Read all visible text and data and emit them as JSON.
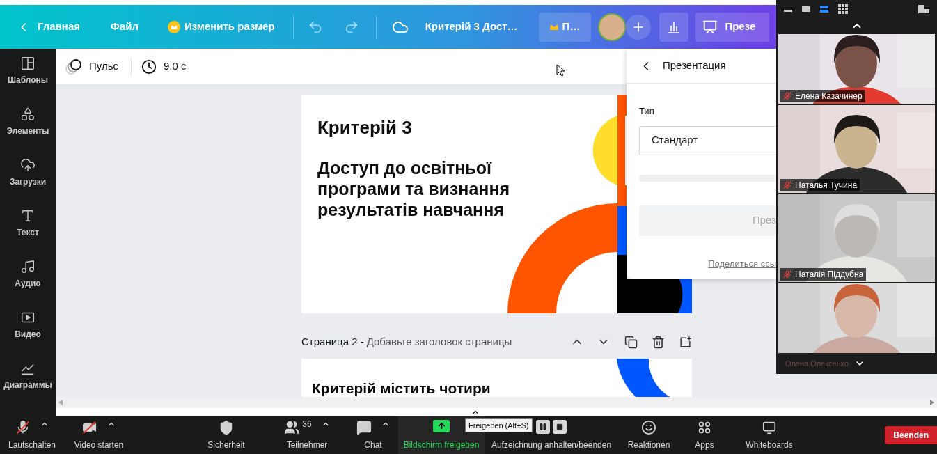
{
  "canva": {
    "header": {
      "back": "Главная",
      "file": "Файл",
      "resize": "Изменить размер",
      "title": "Критерій 3 Дост…",
      "pro": "П…",
      "present": "Презе"
    },
    "toolbar": {
      "animation": "Пульс",
      "duration": "9.0 с"
    },
    "sidebar": [
      {
        "kind": "templates",
        "label": "Шаблоны"
      },
      {
        "kind": "elements",
        "label": "Элементы"
      },
      {
        "kind": "uploads",
        "label": "Загрузки"
      },
      {
        "kind": "text",
        "label": "Текст"
      },
      {
        "kind": "audio",
        "label": "Аудио"
      },
      {
        "kind": "video",
        "label": "Видео"
      },
      {
        "kind": "charts",
        "label": "Диаграммы"
      }
    ],
    "slide_1": {
      "heading": "Критерій 3",
      "subheading": "Доступ до освітньої програми та визнання результатів навчання"
    },
    "page_2": {
      "label": "Страница 2 -",
      "title_placeholder": "Добавьте заголовок страницы",
      "slide_text": "Критерій містить чотири"
    },
    "present_panel": {
      "title": "Презентация",
      "type_label": "Тип",
      "type_value": "Стандарт",
      "button": "През",
      "share_link": "Поделиться ссы"
    }
  },
  "zoom": {
    "gallery": {
      "tiles": [
        {
          "name": "Елена Казачинер",
          "muted": true
        },
        {
          "name": "Наталья Тучина",
          "muted": true
        },
        {
          "name": "Наталія Піддубна",
          "muted": true
        }
      ],
      "partial_name": "Олена Олексенко"
    },
    "toolbar": [
      {
        "kind": "mic",
        "label": "Lautschalten",
        "off": true,
        "menu": true
      },
      {
        "kind": "video",
        "label": "Video starten",
        "off": true,
        "menu": true
      },
      {
        "kind": "security",
        "label": "Sicherheit",
        "off": false,
        "menu": false
      },
      {
        "kind": "participants",
        "label": "Teilnehmer",
        "count": "36",
        "off": false,
        "menu": true
      },
      {
        "kind": "chat",
        "label": "Chat",
        "off": false,
        "menu": true
      },
      {
        "kind": "share",
        "label": "Bildschirm freigeben",
        "off": false,
        "menu": false
      },
      {
        "kind": "record",
        "label": "Aufzeichnung anhalten/beenden",
        "off": false,
        "menu": false
      },
      {
        "kind": "reactions",
        "label": "Reaktionen",
        "off": false,
        "menu": false
      },
      {
        "kind": "apps",
        "label": "Apps",
        "off": false,
        "menu": false
      },
      {
        "kind": "whiteboards",
        "label": "Whiteboards",
        "off": false,
        "menu": false
      }
    ],
    "tooltip": "Freigeben (Alt+S)",
    "end": "Beenden"
  }
}
